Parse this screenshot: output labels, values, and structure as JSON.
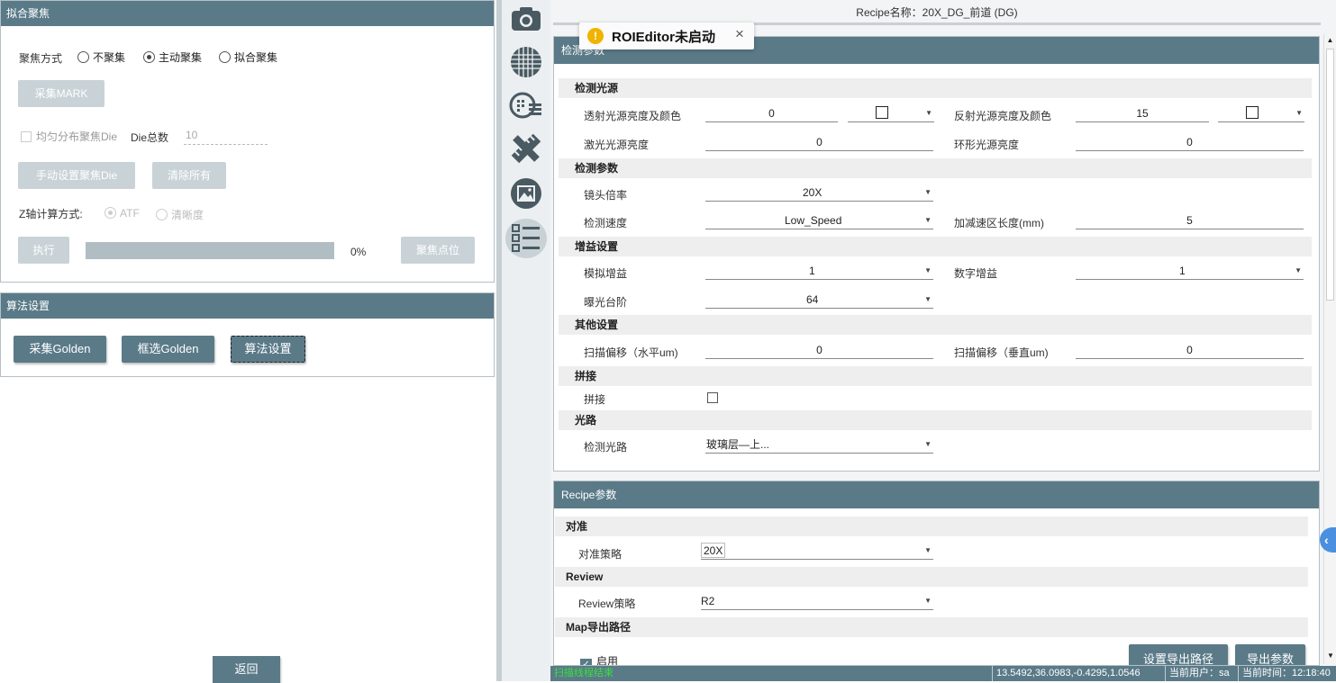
{
  "left": {
    "focus_panel": {
      "title": "拟合聚焦",
      "focus_mode_label": "聚焦方式",
      "focus_modes": [
        "不聚集",
        "主动聚集",
        "拟合聚集"
      ],
      "focus_selected": "主动聚集",
      "collect_mark": "采集MARK",
      "uniform_label": "均匀分布聚焦Die",
      "die_total_label": "Die总数",
      "die_total_value": "10",
      "manual_die": "手动设置聚焦Die",
      "clear_all": "清除所有",
      "z_axis_label": "Z轴计算方式:",
      "z_modes": [
        "ATF",
        "清晰度"
      ],
      "execute": "执行",
      "progress_text": "0%",
      "progress_value": 0,
      "focus_point": "聚焦点位"
    },
    "algo_panel": {
      "title": "算法设置",
      "collect_golden": "采集Golden",
      "select_golden": "框选Golden",
      "algo_settings": "算法设置"
    },
    "back": "返回"
  },
  "toolbar": {
    "icons": [
      "camera-icon",
      "wafer-grid-icon",
      "wafer-list-icon",
      "ruler-icon",
      "image-frame-icon",
      "checklist-icon"
    ]
  },
  "recipe_name": "Recipe名称：20X_DG_前道 (DG)",
  "notification": {
    "text": "ROIEditor未启动",
    "close": "×"
  },
  "detect_panel": {
    "title": "检测参数",
    "light_section": "检测光源",
    "trans_label": "透射光源亮度及颜色",
    "trans_value": "0",
    "reflect_label": "反射光源亮度及颜色",
    "reflect_value": "15",
    "laser_label": "激光光源亮度",
    "laser_value": "0",
    "ring_label": "环形光源亮度",
    "ring_value": "0",
    "param_section": "检测参数",
    "lens_label": "镜头倍率",
    "lens_value": "20X",
    "speed_label": "检测速度",
    "speed_value": "Low_Speed",
    "accel_label": "加减速区长度(mm)",
    "accel_value": "5",
    "gain_section": "增益设置",
    "analog_label": "模拟增益",
    "analog_value": "1",
    "digital_label": "数字增益",
    "digital_value": "1",
    "exposure_label": "曝光台阶",
    "exposure_value": "64",
    "other_section": "其他设置",
    "scan_h_label": "扫描偏移（水平um)",
    "scan_h_value": "0",
    "scan_v_label": "扫描偏移（垂直um)",
    "scan_v_value": "0",
    "stitch_section": "拼接",
    "stitch_label": "拼接",
    "optical_section": "光路",
    "optical_label": "检测光路",
    "optical_value": "玻璃层—上..."
  },
  "recipe_panel": {
    "title": "Recipe参数",
    "align_section": "对准",
    "align_label": "对准策略",
    "align_value": "20X",
    "review_section": "Review",
    "review_label": "Review策略",
    "review_value": "R2",
    "map_section": "Map导出路径",
    "enable_label": "启用",
    "set_path": "设置导出路径",
    "export_params": "导出参数"
  },
  "status": {
    "left": "扫描线程结束",
    "coords": "13.5492,36.0983,-0.4295,1.0546",
    "user": "当前用户：sa",
    "time": "当前时间：12:18:40"
  }
}
